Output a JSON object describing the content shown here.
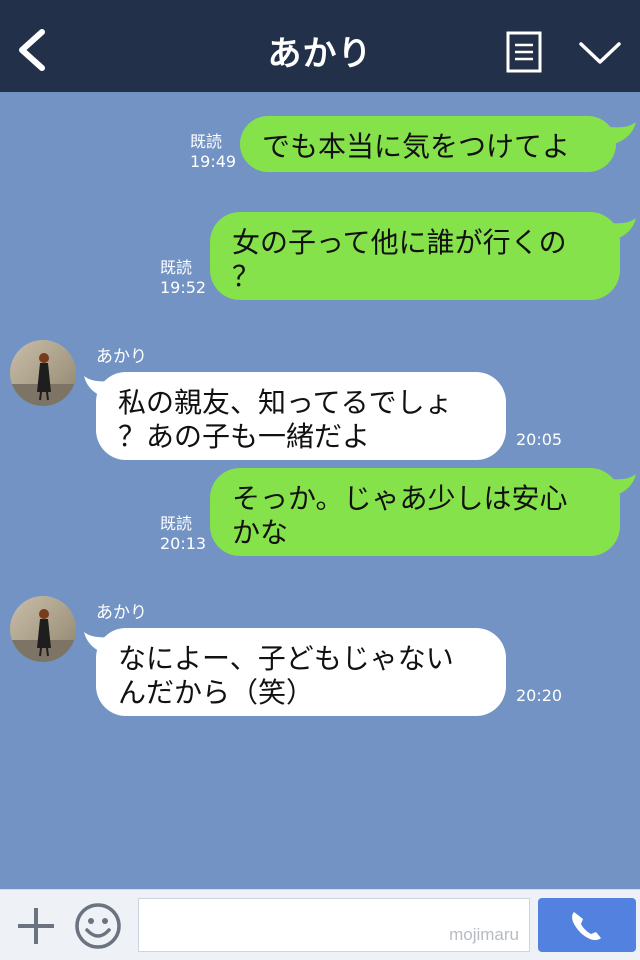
{
  "header": {
    "title": "あかり"
  },
  "messages": [
    {
      "side": "right",
      "text_lines": [
        "でも本当に気をつけてよ"
      ],
      "read": "既読",
      "time": "19:49"
    },
    {
      "side": "right",
      "text_lines": [
        "女の子って他に誰が行くの",
        "？"
      ],
      "read": "既読",
      "time": "19:52"
    },
    {
      "side": "left",
      "sender": "あかり",
      "text_lines": [
        "私の親友、知ってるでしょ",
        "？あの子も一緒だよ"
      ],
      "time": "20:05"
    },
    {
      "side": "right",
      "text_lines": [
        "そっか。じゃあ少しは安心",
        "かな"
      ],
      "read": "既読",
      "time": "20:13"
    },
    {
      "side": "left",
      "sender": "あかり",
      "text_lines": [
        "なによー、子どもじゃない",
        "んだから（笑）"
      ],
      "time": "20:20"
    }
  ],
  "footer": {
    "watermark": "mojimaru"
  },
  "colors": {
    "header_bg": "#233049",
    "chat_bg": "#7293c4",
    "bubble_sent": "#85e24a",
    "bubble_received": "#ffffff",
    "call_button": "#5381e0"
  },
  "icons": {
    "back": "chevron-left-icon",
    "notes": "notes-icon",
    "menu": "chevron-down-icon",
    "plus": "plus-icon",
    "emoji": "smiley-icon",
    "call": "phone-icon"
  }
}
